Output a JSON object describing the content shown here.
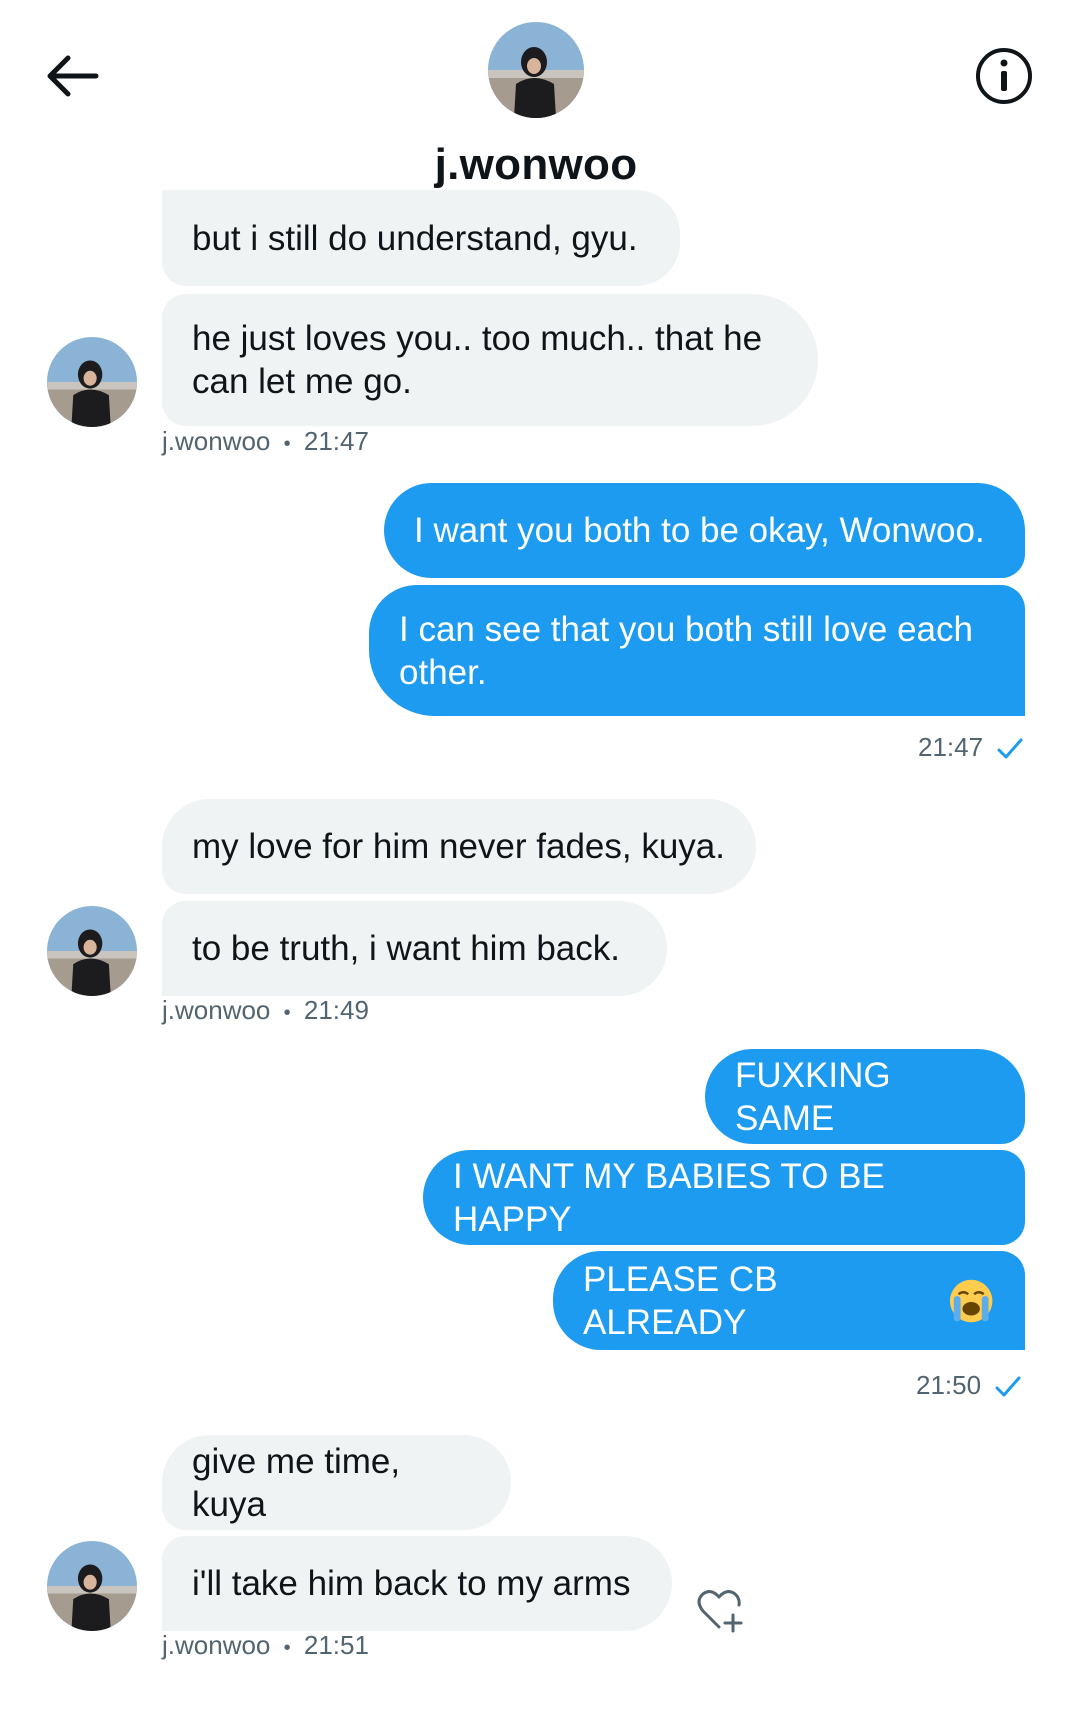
{
  "header": {
    "name": "j.wonwoo",
    "back_icon": "arrow-left-icon",
    "info_icon": "info-circle-icon"
  },
  "messages": [
    {
      "dir": "in",
      "text": "but i still do understand, gyu."
    },
    {
      "dir": "in",
      "text": "he just loves you.. too much.. that he can let me go."
    },
    {
      "dir": "in-meta",
      "sender": "j.wonwoo",
      "dot": "•",
      "time": "21:47"
    },
    {
      "dir": "out",
      "text": "I want you both to be okay, Wonwoo."
    },
    {
      "dir": "out",
      "text": "I can see that you both still love each other."
    },
    {
      "dir": "out-meta",
      "time": "21:47"
    },
    {
      "dir": "in",
      "text": "my love for him never fades, kuya."
    },
    {
      "dir": "in",
      "text": "to be truth, i want him back."
    },
    {
      "dir": "in-meta",
      "sender": "j.wonwoo",
      "dot": "•",
      "time": "21:49"
    },
    {
      "dir": "out",
      "text": "FUXKING SAME"
    },
    {
      "dir": "out",
      "text": "I WANT MY BABIES TO BE HAPPY"
    },
    {
      "dir": "out",
      "text": "PLEASE CB ALREADY",
      "emoji": "loudly-crying-face-emoji"
    },
    {
      "dir": "out-meta",
      "time": "21:50"
    },
    {
      "dir": "in",
      "text": "give me time, kuya"
    },
    {
      "dir": "in",
      "text": "i'll take him back to my arms"
    },
    {
      "dir": "in-meta",
      "sender": "j.wonwoo",
      "dot": "•",
      "time": "21:51"
    }
  ],
  "colors": {
    "outgoing": "#1d9bf0",
    "incoming": "#eff3f4",
    "meta": "#536471"
  }
}
